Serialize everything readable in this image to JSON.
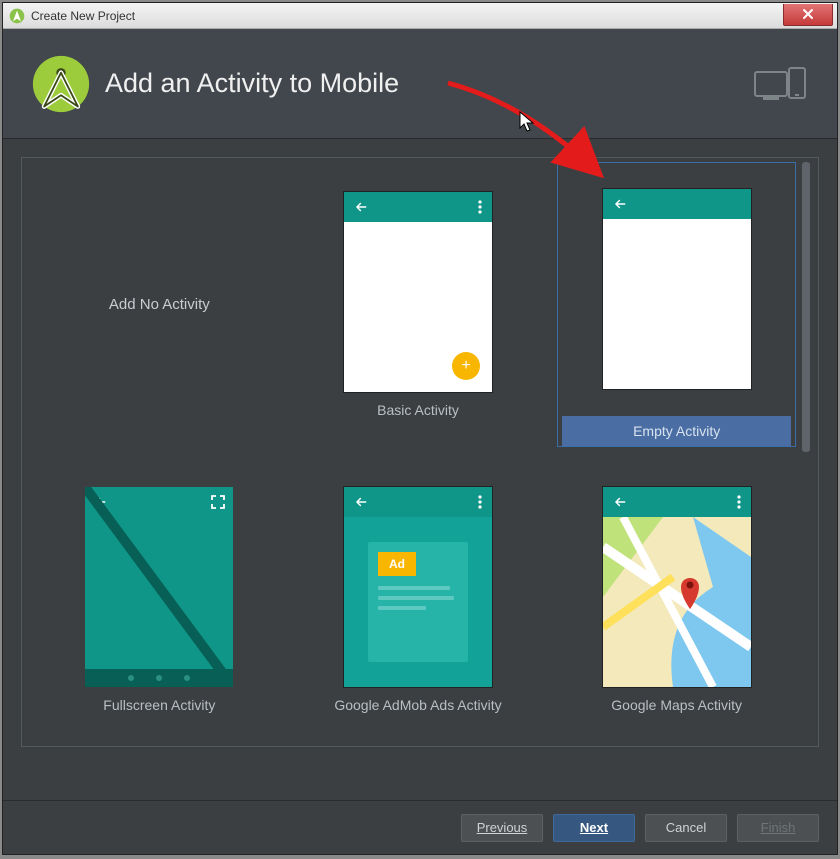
{
  "window": {
    "title": "Create New Project"
  },
  "header": {
    "title": "Add an Activity to Mobile"
  },
  "activities": {
    "none": "Add No Activity",
    "basic": "Basic Activity",
    "empty": "Empty Activity",
    "fullscreen": "Fullscreen Activity",
    "admob": "Google AdMob Ads Activity",
    "maps": "Google Maps Activity",
    "ad_badge": "Ad"
  },
  "selected": "empty",
  "buttons": {
    "previous": "Previous",
    "next": "Next",
    "cancel": "Cancel",
    "finish": "Finish"
  },
  "colors": {
    "teal": "#0f9688",
    "accent": "#f9b600",
    "selection": "#4a6ea3"
  }
}
